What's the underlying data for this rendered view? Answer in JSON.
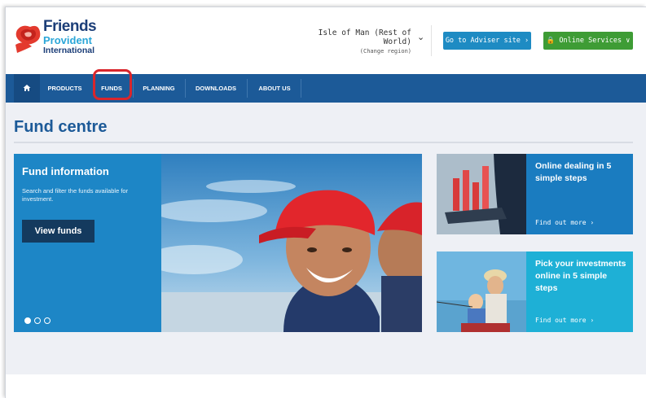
{
  "brand": {
    "line1": "Friends",
    "line2": "Provident",
    "line3": "International"
  },
  "region": {
    "name": "Isle of Man (Rest of World)",
    "change": "(Change region)"
  },
  "header_buttons": {
    "adviser": "Go to Adviser site ›",
    "online": "🔒 Online Services ∨"
  },
  "nav": {
    "items": [
      "PRODUCTS",
      "FUNDS",
      "PLANNING",
      "DOWNLOADS",
      "ABOUT US"
    ],
    "highlighted": "FUNDS"
  },
  "page": {
    "title": "Fund centre"
  },
  "hero": {
    "title": "Fund information",
    "description": "Search and filter the funds available for investment.",
    "button": "View funds",
    "slides": 3,
    "active_slide": 1
  },
  "promos": [
    {
      "title": "Online dealing in 5 simple steps",
      "link": "Find out more ›"
    },
    {
      "title": "Pick your investments online in 5 simple steps",
      "link": "Find out more ›"
    }
  ],
  "colors": {
    "nav": "#1c5a98",
    "hero_panel": "#1d86c6",
    "adviser_btn": "#1e8bc3",
    "online_btn": "#3e9c35",
    "highlight": "#d9262c"
  }
}
